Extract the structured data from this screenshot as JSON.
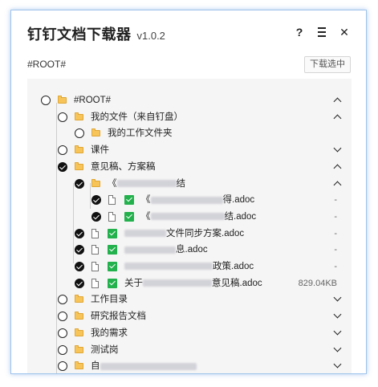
{
  "app": {
    "title": "钉钉文档下载器",
    "version": "v1.0.2",
    "help_label": "?",
    "close_label": "✕"
  },
  "root_label": "#ROOT#",
  "download_button": "下载选中",
  "tree": [
    {
      "label": "#ROOT#",
      "type": "folder",
      "checked": false,
      "chevron": "up"
    },
    {
      "label": "我的文件（来自钉盘）",
      "type": "folder",
      "checked": false,
      "chevron": "up"
    },
    {
      "label": "我的工作文件夹",
      "type": "folder",
      "checked": false,
      "chevron": ""
    },
    {
      "label": "课件",
      "type": "folder",
      "checked": false,
      "chevron": "down"
    },
    {
      "label": "意见稿、方案稿",
      "type": "folder",
      "checked": true,
      "chevron": "up"
    },
    {
      "label_prefix": "《",
      "label_suffix": "结",
      "type": "folder",
      "checked": true,
      "chevron": "up"
    },
    {
      "label_prefix": "《",
      "label_suffix": "得.adoc",
      "type": "file",
      "checked": true,
      "size": "-"
    },
    {
      "label_prefix": "《",
      "label_suffix": "结.adoc",
      "type": "file",
      "checked": true,
      "size": "-"
    },
    {
      "label_prefix": "",
      "label_suffix": "文件同步方案.adoc",
      "type": "file",
      "checked": true,
      "size": "-"
    },
    {
      "label_prefix": "",
      "label_suffix": "息.adoc",
      "type": "file",
      "checked": true,
      "size": "-"
    },
    {
      "label_prefix": "",
      "label_suffix": "政策.adoc",
      "type": "file",
      "checked": true,
      "size": "-"
    },
    {
      "label_prefix": "关于",
      "label_suffix": "意见稿.adoc",
      "type": "file",
      "checked": true,
      "size": "829.04KB"
    },
    {
      "label": "工作目录",
      "type": "folder",
      "checked": false,
      "chevron": "down"
    },
    {
      "label": "研究报告文档",
      "type": "folder",
      "checked": false,
      "chevron": "down"
    },
    {
      "label": "我的需求",
      "type": "folder",
      "checked": false,
      "chevron": "down"
    },
    {
      "label": "测试岗",
      "type": "folder",
      "checked": false,
      "chevron": "down"
    },
    {
      "label_prefix": "自",
      "label_suffix": "",
      "type": "folder",
      "checked": false,
      "chevron": "down"
    }
  ]
}
